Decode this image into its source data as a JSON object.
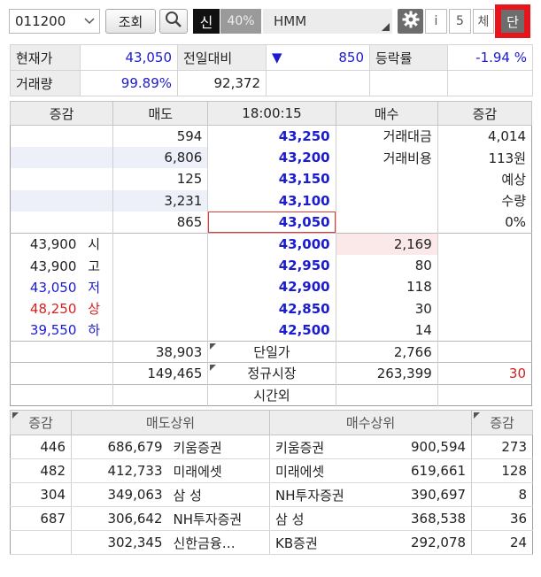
{
  "toolbar": {
    "code": "011200",
    "search_label": "조회",
    "shin_label": "신",
    "ratio_label": "40%",
    "stock_name": "HMM",
    "i_label": "i",
    "five_label": "5",
    "che_label": "체",
    "dan_label": "단"
  },
  "summary": {
    "price_label": "현재가",
    "price": "43,050",
    "change_label": "전일대비",
    "change_arrow": "▼",
    "change": "850",
    "rate_label": "등락률",
    "rate": "-1.94 %",
    "volume_label": "거래량",
    "volume_ratio": "99.89%",
    "volume": "92,372"
  },
  "book": {
    "headers": [
      "증감",
      "매도",
      "18:00:15",
      "매수",
      "증감"
    ],
    "asks": [
      {
        "qty": "594",
        "price": "43,250"
      },
      {
        "qty": "6,806",
        "price": "43,200"
      },
      {
        "qty": "125",
        "price": "43,150"
      },
      {
        "qty": "3,231",
        "price": "43,100"
      },
      {
        "qty": "865",
        "price": "43,050"
      }
    ],
    "ask_info": [
      {
        "label": "거래대금",
        "value": "4,014"
      },
      {
        "label": "거래비용",
        "value": "113원"
      },
      {
        "label": "",
        "value": "예상"
      },
      {
        "label": "",
        "value": "수량"
      },
      {
        "label": "",
        "value": "0%"
      }
    ],
    "bids": [
      {
        "info_value": "43,900",
        "info_label": "시",
        "price": "43,000",
        "qty": "2,169"
      },
      {
        "info_value": "43,900",
        "info_label": "고",
        "price": "42,950",
        "qty": "80"
      },
      {
        "info_value": "43,050",
        "info_label": "저",
        "price": "42,900",
        "qty": "118"
      },
      {
        "info_value": "48,250",
        "info_label": "상",
        "price": "42,850",
        "qty": "30"
      },
      {
        "info_value": "39,550",
        "info_label": "하",
        "price": "42,500",
        "qty": "14"
      }
    ],
    "totals": [
      {
        "sell": "38,903",
        "label": "단일가",
        "buy": "2,766",
        "diff": ""
      },
      {
        "sell": "149,465",
        "label": "정규시장",
        "buy": "263,399",
        "diff": "30"
      },
      {
        "sell": "",
        "label": "시간외",
        "buy": "",
        "diff": ""
      }
    ]
  },
  "brokers": {
    "headers": [
      "증감",
      "매도상위",
      "매수상위",
      "증감"
    ],
    "rows": [
      {
        "sell_diff": "446",
        "sell_qty": "686,679",
        "sell_name": "키움증권",
        "buy_name": "키움증권",
        "buy_qty": "900,594",
        "buy_diff": "273"
      },
      {
        "sell_diff": "482",
        "sell_qty": "412,733",
        "sell_name": "미래에셋",
        "buy_name": "미래에셋",
        "buy_qty": "619,661",
        "buy_diff": "128"
      },
      {
        "sell_diff": "304",
        "sell_qty": "349,063",
        "sell_name": "삼 성",
        "buy_name": "NH투자증권",
        "buy_qty": "390,697",
        "buy_diff": "8"
      },
      {
        "sell_diff": "687",
        "sell_qty": "306,642",
        "sell_name": "NH투자증권",
        "buy_name": "삼 성",
        "buy_qty": "368,538",
        "buy_diff": "36"
      },
      {
        "sell_diff": "",
        "sell_qty": "302,345",
        "sell_name": "신한금융…",
        "buy_name": "KB증권",
        "buy_qty": "292,078",
        "buy_diff": "24"
      }
    ]
  }
}
